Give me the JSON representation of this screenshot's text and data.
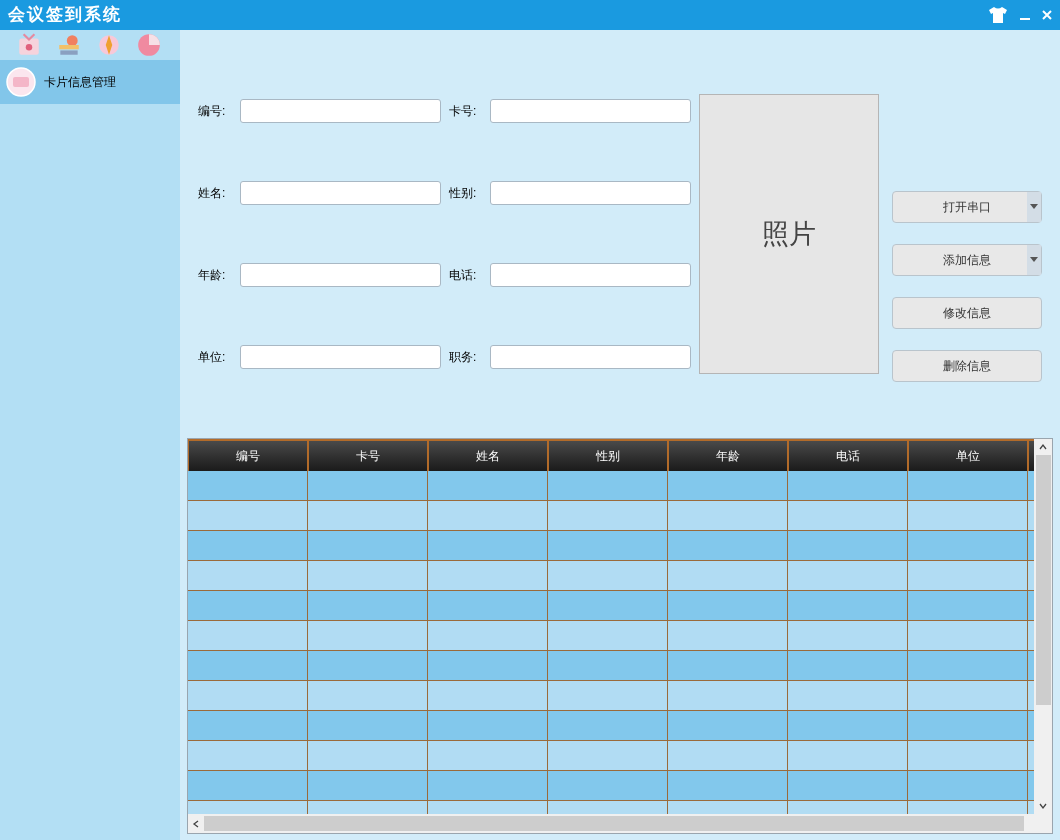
{
  "window": {
    "title": "会议签到系统"
  },
  "sidebar": {
    "items": [
      {
        "label": "卡片信息管理",
        "selected": true
      }
    ]
  },
  "form": {
    "fields": [
      {
        "label": "编号:"
      },
      {
        "label": "卡号:"
      },
      {
        "label": "姓名:"
      },
      {
        "label": "性别:"
      },
      {
        "label": "年龄:"
      },
      {
        "label": "电话:"
      },
      {
        "label": "单位:"
      },
      {
        "label": "职务:"
      }
    ],
    "photo": "照片"
  },
  "buttons": [
    {
      "label": "打开串口",
      "kind": "dropdown"
    },
    {
      "label": "添加信息",
      "kind": "dropdown"
    },
    {
      "label": "修改信息",
      "kind": "plain"
    },
    {
      "label": "删除信息",
      "kind": "plain"
    }
  ],
  "table": {
    "columns": [
      "编号",
      "卡号",
      "姓名",
      "性别",
      "年龄",
      "电话",
      "单位"
    ]
  }
}
